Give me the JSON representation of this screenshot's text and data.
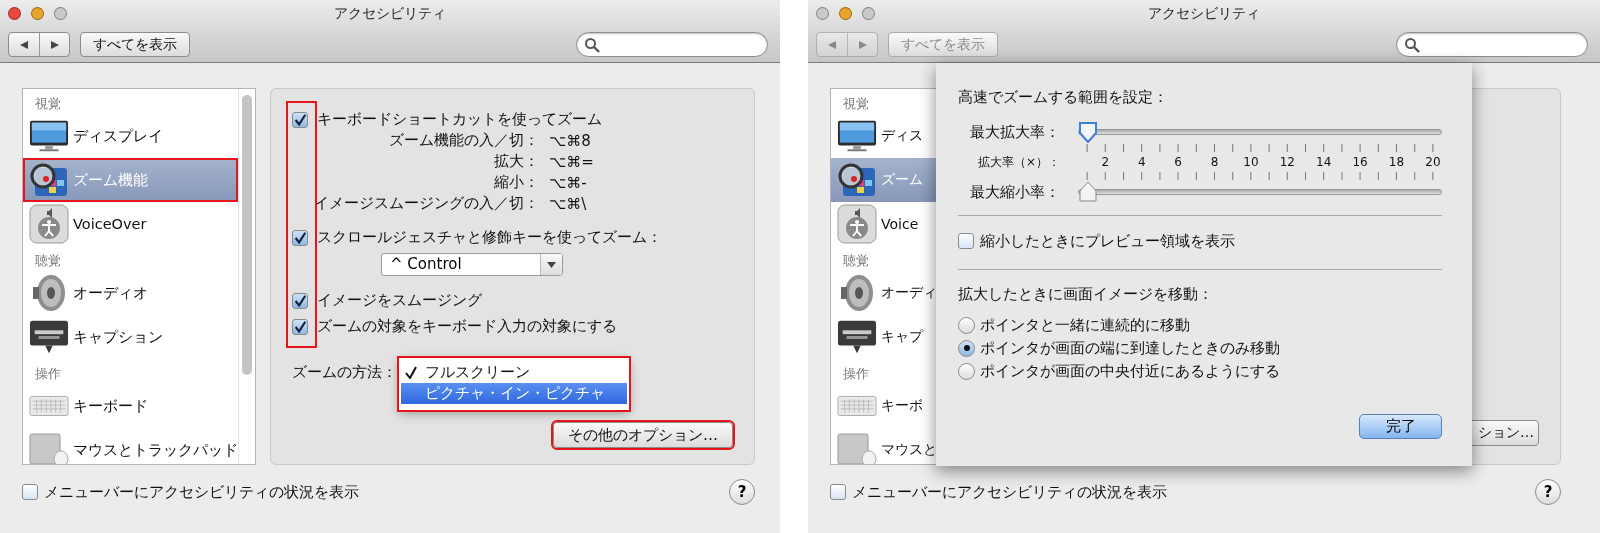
{
  "windows": [
    {
      "title": "アクセシビリティ",
      "traffic_lights": [
        {
          "color": "#e8483f"
        },
        {
          "color": "#e9a42c"
        },
        {
          "color": "#c9c9c9"
        }
      ],
      "toolbar": {
        "nav_disabled": false,
        "show_all": {
          "label": "すべてを表示",
          "disabled": false
        }
      },
      "sidebar": {
        "items": [
          {
            "kind": "header",
            "label": "視覚"
          },
          {
            "kind": "item",
            "label": "ディスプレイ",
            "selected": false,
            "highlighted": false
          },
          {
            "kind": "item",
            "label": "ズーム機能",
            "selected": true,
            "highlighted": true
          },
          {
            "kind": "item",
            "label": "VoiceOver",
            "selected": false,
            "highlighted": false
          },
          {
            "kind": "header",
            "label": "聴覚"
          },
          {
            "kind": "item",
            "label": "オーディオ",
            "selected": false,
            "highlighted": false
          },
          {
            "kind": "item",
            "label": "キャプション",
            "selected": false,
            "highlighted": false
          },
          {
            "kind": "header",
            "label": "操作"
          },
          {
            "kind": "item",
            "label": "キーボード",
            "selected": false,
            "highlighted": false
          },
          {
            "kind": "item",
            "label": "マウスとトラックパッド",
            "selected": false,
            "highlighted": false
          }
        ]
      },
      "panel": {
        "checkboxes_highlighted": true,
        "options": [
          {
            "kind": "checkbox",
            "label": "キーボードショートカットを使ってズーム",
            "checked": true
          },
          {
            "kind": "shortcut",
            "label": "ズーム機能の入／切：",
            "keys": "⌥⌘8"
          },
          {
            "kind": "shortcut",
            "label": "拡大：",
            "keys": "⌥⌘="
          },
          {
            "kind": "shortcut",
            "label": "縮小：",
            "keys": "⌥⌘-"
          },
          {
            "kind": "shortcut",
            "label": "イメージスムージングの入／切：",
            "keys": "⌥⌘\\"
          },
          {
            "kind": "checkbox",
            "label": "スクロールジェスチャと修飾キーを使ってズーム：",
            "checked": true
          },
          {
            "kind": "popup",
            "value": "^ Control"
          },
          {
            "kind": "checkbox",
            "label": "イメージをスムージング",
            "checked": true
          },
          {
            "kind": "checkbox",
            "label": "ズームの対象をキーボード入力の対象にする",
            "checked": true
          }
        ],
        "zoom_style": {
          "label": "ズームの方法：",
          "highlighted": true,
          "menu": [
            {
              "label": "フルスクリーン",
              "checked": true,
              "selected": false
            },
            {
              "label": "ピクチャ・イン・ピクチャ",
              "checked": false,
              "selected": true
            }
          ]
        },
        "more_button": {
          "label": "その他のオプション…",
          "highlighted": true
        }
      },
      "footer": {
        "label": "メニューバーにアクセシビリティの状況を表示",
        "checked": false,
        "help": "?"
      }
    },
    {
      "title": "アクセシビリティ",
      "traffic_lights": [
        {
          "color": "#c9c9c9"
        },
        {
          "color": "#e9a42c"
        },
        {
          "color": "#c9c9c9"
        }
      ],
      "toolbar": {
        "nav_disabled": true,
        "show_all": {
          "label": "すべてを表示",
          "disabled": true
        }
      },
      "sidebar": {
        "items": [
          {
            "kind": "header",
            "label": "視覚"
          },
          {
            "kind": "item",
            "label": "ディス",
            "selected": false,
            "highlighted": false
          },
          {
            "kind": "item",
            "label": "ズーム",
            "selected": true,
            "highlighted": false
          },
          {
            "kind": "item",
            "label": "Voice",
            "selected": false,
            "highlighted": false
          },
          {
            "kind": "header",
            "label": "聴覚"
          },
          {
            "kind": "item",
            "label": "オーディ",
            "selected": false,
            "highlighted": false
          },
          {
            "kind": "item",
            "label": "キャプ",
            "selected": false,
            "highlighted": false
          },
          {
            "kind": "header",
            "label": "操作"
          },
          {
            "kind": "item",
            "label": "キーボ",
            "selected": false,
            "highlighted": false
          },
          {
            "kind": "item",
            "label": "マウスと",
            "selected": false,
            "highlighted": false
          }
        ]
      },
      "panel": {
        "more_button": {
          "label": "ション…",
          "highlighted": false
        }
      },
      "sheet": {
        "heading": "高速でズームする範囲を設定：",
        "sliders": [
          {
            "label": "最大拡大率：",
            "level": 0,
            "focused": true
          },
          {
            "label": "最大縮小率：",
            "level": 0,
            "focused": false
          }
        ],
        "scale_label": "拡大率（×）：",
        "scale": [
          "2",
          "4",
          "6",
          "8",
          "10",
          "12",
          "14",
          "16",
          "18",
          "20"
        ],
        "preview": {
          "label": "縮小したときにプレビュー領域を表示",
          "checked": false
        },
        "move_heading": "拡大したときに画面イメージを移動：",
        "move_options": [
          {
            "label": "ポインタと一緒に連続的に移動",
            "selected": false
          },
          {
            "label": "ポインタが画面の端に到達したときのみ移動",
            "selected": true
          },
          {
            "label": "ポインタが画面の中央付近にあるようにする",
            "selected": false
          }
        ],
        "done": "完了"
      },
      "footer": {
        "label": "メニューバーにアクセシビリティの状況を表示",
        "checked": false,
        "help": "?"
      }
    }
  ]
}
